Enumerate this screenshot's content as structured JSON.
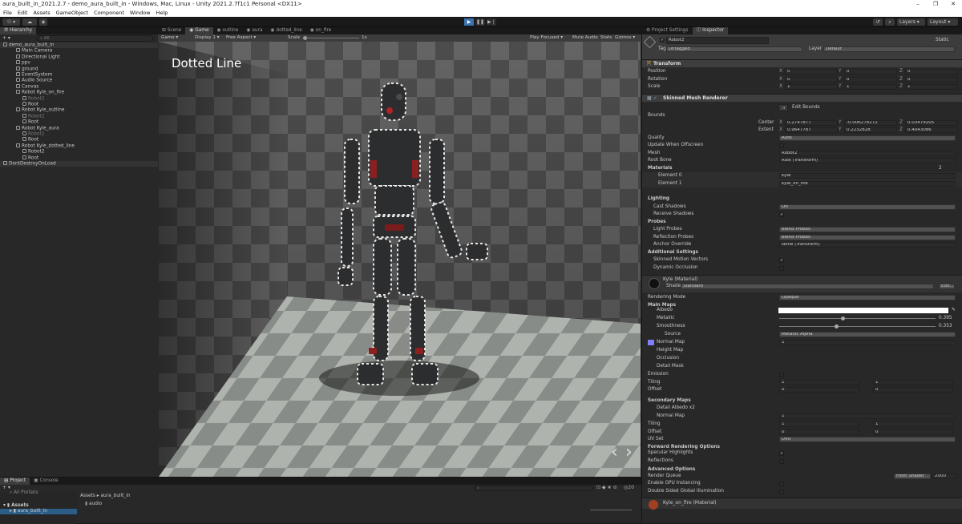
{
  "window": {
    "title": "aura_built_in_2021.2.7 - demo_aura_built_in - Windows, Mac, Linux - Unity 2021.2.7f1c1 Personal <DX11>",
    "min": "–",
    "max": "❐",
    "close": "✕"
  },
  "menu": [
    "File",
    "Edit",
    "Assets",
    "GameObject",
    "Component",
    "Window",
    "Help"
  ],
  "toolbar": {
    "layers": "Layers",
    "layout": "Layout"
  },
  "hierarchy": {
    "tab": "Hierarchy",
    "search_placeholder": "All",
    "items": [
      {
        "label": "demo_aura_built_in",
        "indent": 0,
        "dim": false
      },
      {
        "label": "Main Camera",
        "indent": 2,
        "dim": false
      },
      {
        "label": "Directional Light",
        "indent": 2,
        "dim": false
      },
      {
        "label": "ppv",
        "indent": 2,
        "dim": false
      },
      {
        "label": "ground",
        "indent": 2,
        "dim": false
      },
      {
        "label": "EventSystem",
        "indent": 2,
        "dim": false
      },
      {
        "label": "Audio Source",
        "indent": 2,
        "dim": false
      },
      {
        "label": "Canvas",
        "indent": 2,
        "dim": false
      },
      {
        "label": "Robot Kyle_on_fire",
        "indent": 2,
        "dim": false
      },
      {
        "label": "Robot2",
        "indent": 3,
        "dim": true
      },
      {
        "label": "Root",
        "indent": 3,
        "dim": false
      },
      {
        "label": "Robot Kyle_outline",
        "indent": 2,
        "dim": false
      },
      {
        "label": "Robot2",
        "indent": 3,
        "dim": true
      },
      {
        "label": "Root",
        "indent": 3,
        "dim": false
      },
      {
        "label": "Robot Kyle_aura",
        "indent": 2,
        "dim": false
      },
      {
        "label": "Robot2",
        "indent": 3,
        "dim": true
      },
      {
        "label": "Root",
        "indent": 3,
        "dim": false
      },
      {
        "label": "Robot Kyle_dotted_line",
        "indent": 2,
        "dim": false
      },
      {
        "label": "Robot2",
        "indent": 3,
        "dim": false
      },
      {
        "label": "Root",
        "indent": 3,
        "dim": false
      },
      {
        "label": "DontDestroyOnLoad",
        "indent": 0,
        "dim": false
      }
    ]
  },
  "scene_tabs": [
    "Scene",
    "Game",
    "outline",
    "aura",
    "dotted_line",
    "on_fire"
  ],
  "game_bar": {
    "game": "Game",
    "display": "Display 1",
    "aspect": "Free Aspect",
    "scale_label": "Scale",
    "scale_value": "1x",
    "play_focused": "Play Focused",
    "mute": "Mute Audio",
    "stats": "Stats",
    "gizmos": "Gizmos"
  },
  "game_view": {
    "overlay_title": "Dotted Line",
    "prev": "‹",
    "next": "›"
  },
  "project": {
    "tabs": [
      "Project",
      "Console"
    ],
    "tree": [
      "All Prefabs",
      "Assets",
      "aura_built_in"
    ],
    "breadcrumb": [
      "Assets",
      "aura_built_in"
    ],
    "folders": [
      "audio"
    ],
    "count": "20"
  },
  "inspector": {
    "tabs": [
      "Project Settings",
      "Inspector"
    ],
    "object_name": "Robot2",
    "static": "Static",
    "tag_label": "Tag",
    "tag_value": "Untagged",
    "layer_label": "Layer",
    "layer_value": "Default",
    "transform": {
      "title": "Transform",
      "rows": [
        {
          "label": "Position",
          "x": "0",
          "y": "0",
          "z": "0"
        },
        {
          "label": "Rotation",
          "x": "0",
          "y": "0",
          "z": "0"
        },
        {
          "label": "Scale",
          "x": "1",
          "y": "1",
          "z": "1"
        }
      ]
    },
    "smr": {
      "title": "Skinned Mesh Renderer",
      "edit_bounds": "Edit Bounds",
      "bounds": "Bounds",
      "center": {
        "label": "Center",
        "x": "0.2747877",
        "y": "-0.006278272",
        "z": "0.03479205"
      },
      "extent": {
        "label": "Extent",
        "x": "0.9647787",
        "y": "0.2232828",
        "z": "0.4043086"
      },
      "quality_label": "Quality",
      "quality": "Auto",
      "update_offscreen": "Update When Offscreen",
      "mesh_label": "Mesh",
      "mesh": "Robot2",
      "root_bone_label": "Root Bone",
      "root_bone": "Ribs (Transform)",
      "materials_label": "Materials",
      "materials_count": "2",
      "elements": [
        {
          "label": "Element 0",
          "value": "Kyle"
        },
        {
          "label": "Element 1",
          "value": "Kyle_on_fire"
        }
      ],
      "lighting": "Lighting",
      "cast_shadows_label": "Cast Shadows",
      "cast_shadows": "On",
      "receive_shadows": "Receive Shadows",
      "probes": "Probes",
      "light_probes_label": "Light Probes",
      "light_probes": "Blend Probes",
      "reflection_probes_label": "Reflection Probes",
      "reflection_probes": "Blend Probes",
      "anchor_label": "Anchor Override",
      "anchor": "None (Transform)",
      "additional": "Additional Settings",
      "skinned_motion": "Skinned Motion Vectors",
      "dynamic_occlusion": "Dynamic Occlusion"
    },
    "material": {
      "title": "Kyle (Material)",
      "shader_label": "Shader",
      "shader": "Standard",
      "edit": "Edit...",
      "rendering_mode_label": "Rendering Mode",
      "rendering_mode": "Opaque",
      "main_maps": "Main Maps",
      "albedo": "Albedo",
      "metallic": "Metallic",
      "metallic_value": "0.395",
      "smoothness": "Smoothness",
      "smoothness_value": "0.353",
      "source_label": "Source",
      "source": "Metallic Alpha",
      "normal_map": "Normal Map",
      "normal_value": "1",
      "height_map": "Height Map",
      "occlusion": "Occlusion",
      "detail_mask": "Detail Mask",
      "emission": "Emission",
      "tiling": "Tiling",
      "tiling_x": "1",
      "tiling_y": "1",
      "offset": "Offset",
      "offset_x": "0",
      "offset_y": "0",
      "secondary_maps": "Secondary Maps",
      "detail_albedo": "Detail Albedo x2",
      "sec_normal": "Normal Map",
      "sec_normal_value": "1",
      "sec_tiling_x": "1",
      "sec_tiling_y": "1",
      "sec_offset_x": "0",
      "sec_offset_y": "0",
      "uv_set_label": "UV Set",
      "uv_set": "UV0",
      "forward": "Forward Rendering Options",
      "specular": "Specular Highlights",
      "reflections": "Reflections",
      "advanced": "Advanced Options",
      "render_queue_label": "Render Queue",
      "render_queue_mode": "From Shader",
      "render_queue": "2000",
      "gpu_instancing": "Enable GPU Instancing",
      "double_sided": "Double Sided Global Illumination"
    },
    "next_material": "Kyle_on_fire (Material)"
  },
  "colors": {
    "accent": "#3a72b0",
    "panel": "#282828",
    "header": "#3e3e3e",
    "albedo": "#ffffff",
    "normal_swatch": "#8080ff"
  }
}
